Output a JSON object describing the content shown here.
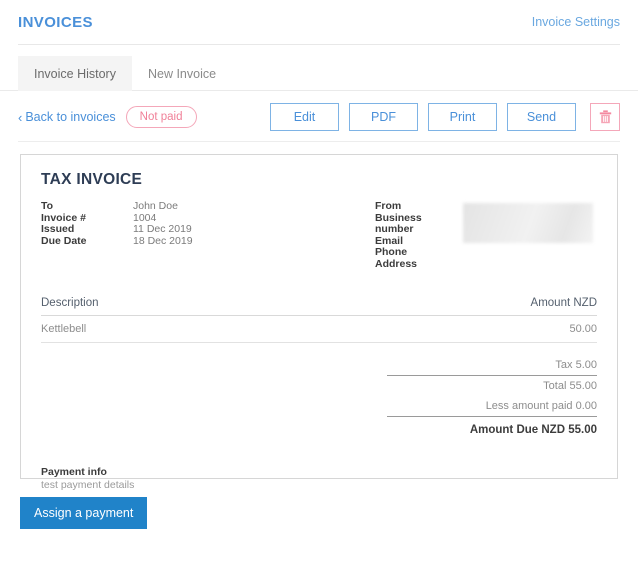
{
  "header": {
    "title": "INVOICES",
    "settings_link": "Invoice Settings"
  },
  "tabs": [
    {
      "label": "Invoice History",
      "active": true
    },
    {
      "label": "New Invoice",
      "active": false
    }
  ],
  "toolbar": {
    "back_label": "Back to invoices",
    "back_chevron": "‹",
    "status": "Not paid",
    "edit_label": "Edit",
    "pdf_label": "PDF",
    "print_label": "Print",
    "send_label": "Send",
    "delete_icon": "trash-icon"
  },
  "invoice": {
    "heading": "TAX INVOICE",
    "meta_labels": [
      "To",
      "Invoice #",
      "Issued",
      "Due Date"
    ],
    "meta_values": [
      "John Doe",
      "1004",
      "11 Dec 2019",
      "18 Dec 2019"
    ],
    "from_labels": [
      "From",
      "Business number",
      "Email",
      "Phone",
      "Address"
    ],
    "from_values_redacted": true,
    "columns": [
      "Description",
      "Amount NZD"
    ],
    "rows": [
      {
        "description": "Kettlebell",
        "amount": "50.00"
      }
    ],
    "totals": [
      {
        "label": "Tax",
        "value": "5.00"
      },
      {
        "label": "Total",
        "value": "55.00"
      },
      {
        "label": "Less amount paid",
        "value": "0.00"
      },
      {
        "label": "Amount Due NZD",
        "value": "55.00"
      }
    ],
    "totals_text": {
      "tax": "Tax 5.00",
      "total": "Total 55.00",
      "less_paid": "Less amount paid 0.00",
      "amount_due": "Amount Due NZD 55.00"
    },
    "payment_title": "Payment info",
    "payment_detail": "test payment details"
  },
  "footer": {
    "assign_payment_label": "Assign a payment"
  },
  "colors": {
    "accent_blue": "#4a90d9",
    "primary_button": "#2083c9",
    "danger_pink": "#f08098",
    "border_pink": "#f4a7b9",
    "card_border": "#d6d6d6"
  }
}
